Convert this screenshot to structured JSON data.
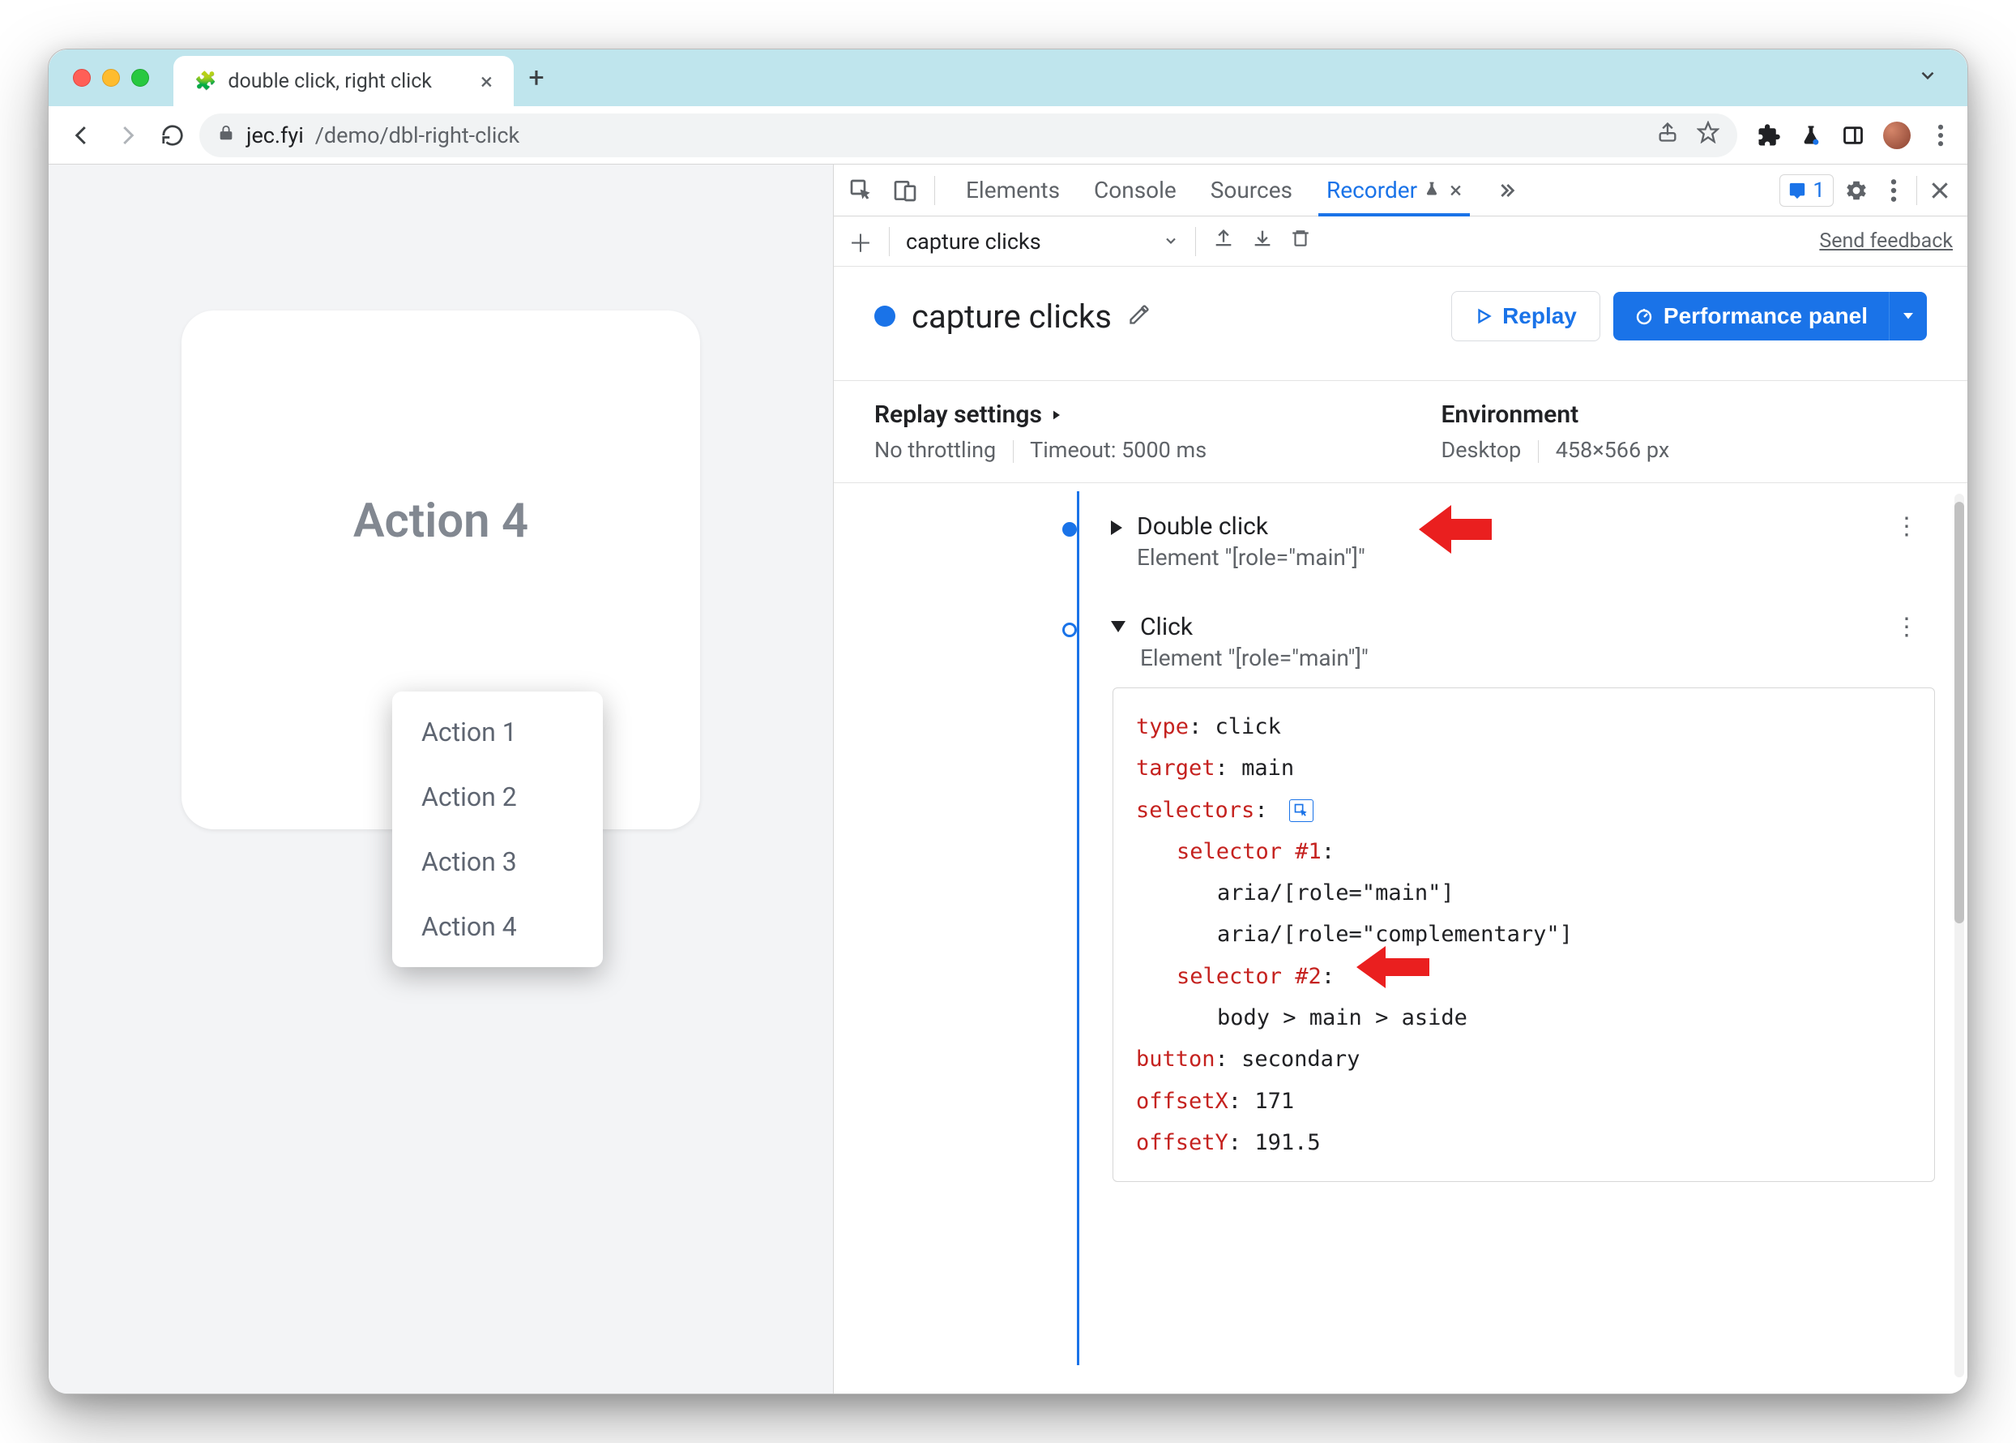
{
  "window": {
    "tab": {
      "title": "double click, right click"
    },
    "url_host": "jec.fyi",
    "url_path": "/demo/dbl-right-click"
  },
  "page": {
    "heading": "Action 4",
    "context_menu": [
      "Action 1",
      "Action 2",
      "Action 3",
      "Action 4"
    ]
  },
  "devtools": {
    "tabs": [
      "Elements",
      "Console",
      "Sources"
    ],
    "active_tab": "Recorder",
    "issues_count": "1",
    "recording_name": "capture clicks",
    "feedback": "Send feedback",
    "title": "capture clicks",
    "replay_label": "Replay",
    "perf_label": "Performance panel",
    "replay_settings_label": "Replay settings",
    "throttling": "No throttling",
    "timeout": "Timeout: 5000 ms",
    "environment_label": "Environment",
    "env_device": "Desktop",
    "env_size": "458×566 px",
    "steps": [
      {
        "title": "Double click",
        "subtitle": "Element \"[role=\"main\"]\""
      },
      {
        "title": "Click",
        "subtitle": "Element \"[role=\"main\"]\""
      }
    ],
    "details": {
      "type_k": "type",
      "type_v": "click",
      "target_k": "target",
      "target_v": "main",
      "selectors_k": "selectors",
      "sel1_k": "selector #1",
      "sel1_a": "aria/[role=\"main\"]",
      "sel1_b": "aria/[role=\"complementary\"]",
      "sel2_k": "selector #2",
      "sel2_a": "body > main > aside",
      "button_k": "button",
      "button_v": "secondary",
      "offx_k": "offsetX",
      "offx_v": "171",
      "offy_k": "offsetY",
      "offy_v": "191.5"
    }
  }
}
